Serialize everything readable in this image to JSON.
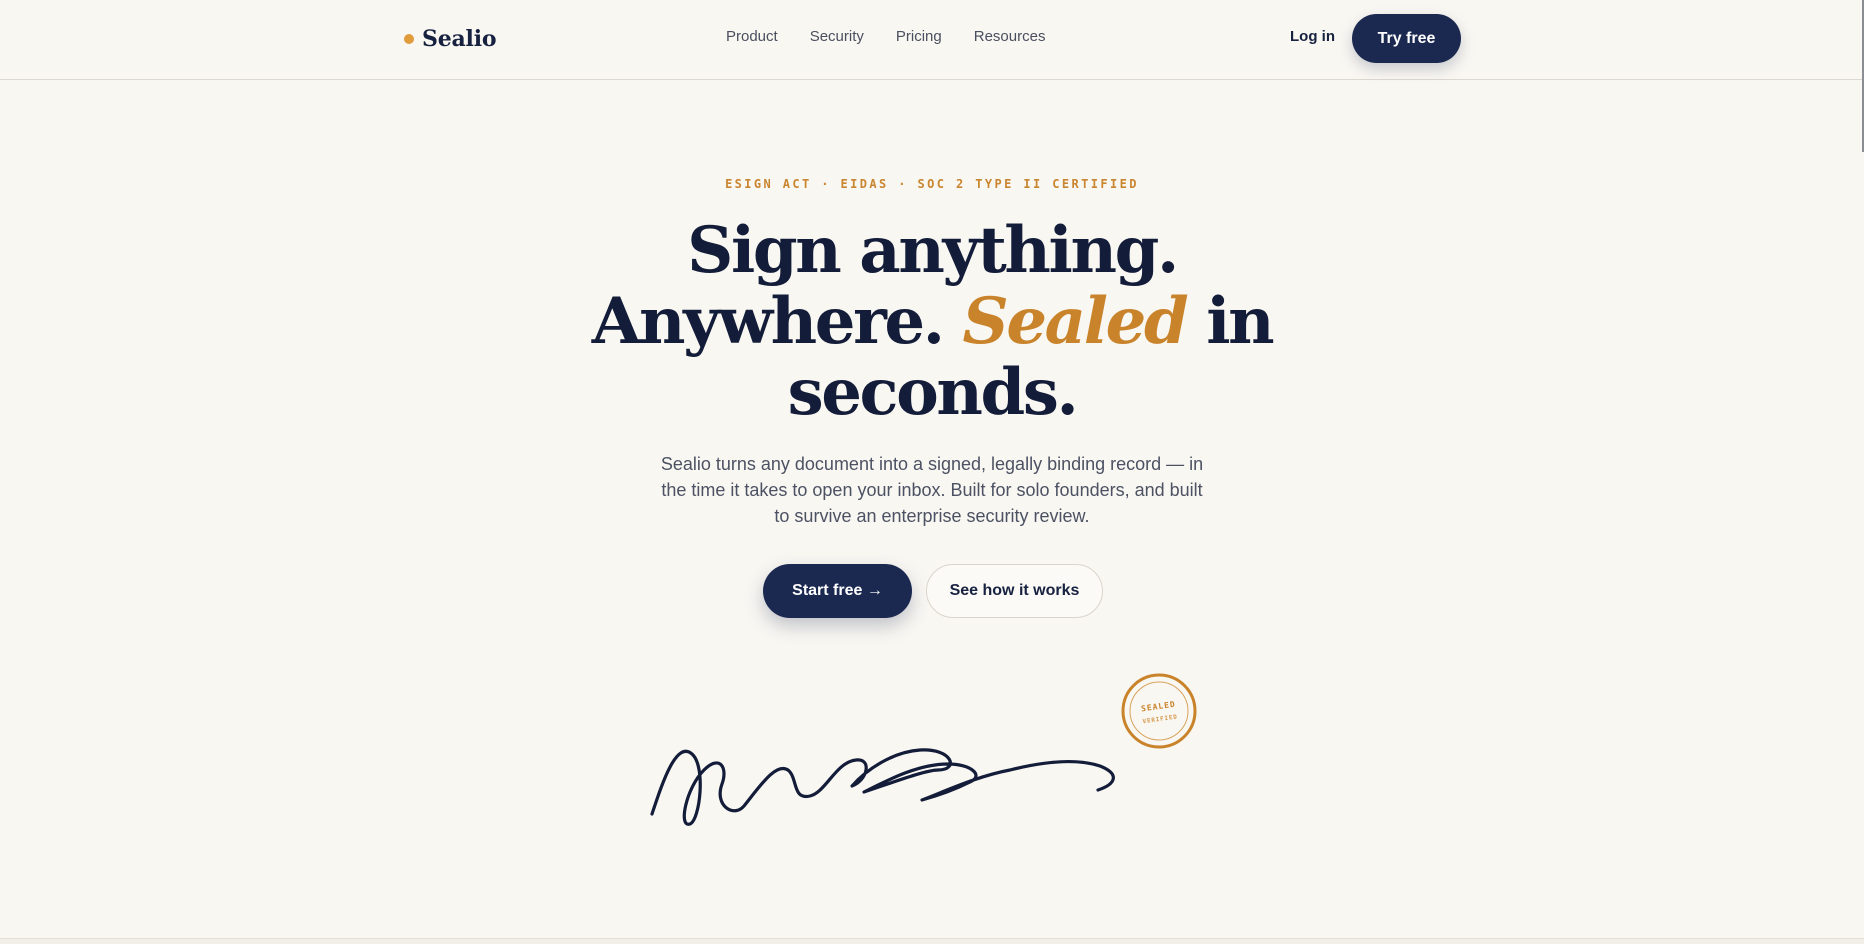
{
  "brand": {
    "name": "Sealio",
    "accent_color": "#e09b3a"
  },
  "nav": {
    "items": [
      {
        "label": "Product"
      },
      {
        "label": "Security"
      },
      {
        "label": "Pricing"
      },
      {
        "label": "Resources"
      }
    ],
    "login_label": "Log in",
    "try_label": "Try free"
  },
  "hero": {
    "eyebrow": "ESIGN ACT · EIDAS · SOC 2 TYPE II CERTIFIED",
    "headline_line1": "Sign anything.",
    "headline_line2_start": "Anywhere.",
    "headline_accent": "Sealed",
    "headline_line2_end": "in",
    "headline_line3": "seconds.",
    "subtitle": "Sealio turns any document into a signed, legally binding record — in the time it takes to open your inbox. Built for solo founders, and built to survive an enterprise security review.",
    "primary_cta": "Start free →",
    "secondary_cta": "See how it works"
  },
  "seal": {
    "top_text": "SEALED",
    "bottom_text": "VERIFIED",
    "color": "#c9832b"
  },
  "colors": {
    "navy": "#1b2850",
    "gold": "#c9832b",
    "background": "#f9f7f2"
  }
}
